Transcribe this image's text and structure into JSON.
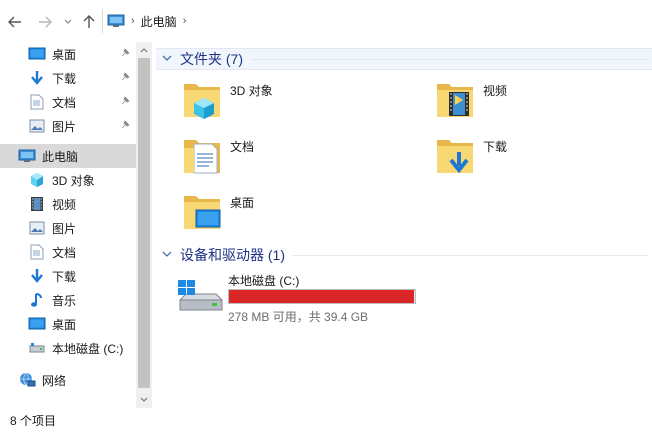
{
  "address": {
    "path_label": "此电脑"
  },
  "nav": {
    "quick_access": [
      {
        "label": "桌面",
        "icon": "desktop-icon",
        "pinned": true
      },
      {
        "label": "下载",
        "icon": "download-arrow-icon",
        "pinned": true
      },
      {
        "label": "文档",
        "icon": "document-icon",
        "pinned": true
      },
      {
        "label": "图片",
        "icon": "picture-icon",
        "pinned": true
      }
    ],
    "this_pc": {
      "label": "此电脑",
      "icon": "computer-icon",
      "selected": true
    },
    "this_pc_children": [
      {
        "label": "3D 对象",
        "icon": "cube-3d-icon"
      },
      {
        "label": "视频",
        "icon": "video-icon"
      },
      {
        "label": "图片",
        "icon": "picture-icon"
      },
      {
        "label": "文档",
        "icon": "document-icon"
      },
      {
        "label": "下载",
        "icon": "download-arrow-icon"
      },
      {
        "label": "音乐",
        "icon": "music-note-icon"
      },
      {
        "label": "桌面",
        "icon": "desktop-icon"
      },
      {
        "label": "本地磁盘 (C:)",
        "icon": "drive-icon"
      }
    ],
    "network": {
      "label": "网络",
      "icon": "network-icon"
    }
  },
  "main": {
    "folders_group": {
      "title": "文件夹 (7)"
    },
    "folders": [
      {
        "name": "3D 对象",
        "icon": "folder-3d-icon"
      },
      {
        "name": "视频",
        "icon": "folder-video-icon"
      },
      {
        "name": "文档",
        "icon": "folder-document-icon"
      },
      {
        "name": "下载",
        "icon": "folder-download-icon"
      },
      {
        "name": "桌面",
        "icon": "folder-desktop-icon"
      }
    ],
    "devices_group": {
      "title": "设备和驱动器 (1)"
    },
    "drive": {
      "name": "本地磁盘 (C:)",
      "free_text": "278 MB 可用，共 39.4 GB",
      "used_fraction": 0.993,
      "bar_color": "#da2626"
    }
  },
  "status": {
    "items_text": "8 个项目"
  },
  "colors": {
    "accent": "#0078d7",
    "group_title": "#1e3287",
    "folder_yellow": "#f8d775",
    "selected_nav": "#d9d9d9"
  }
}
